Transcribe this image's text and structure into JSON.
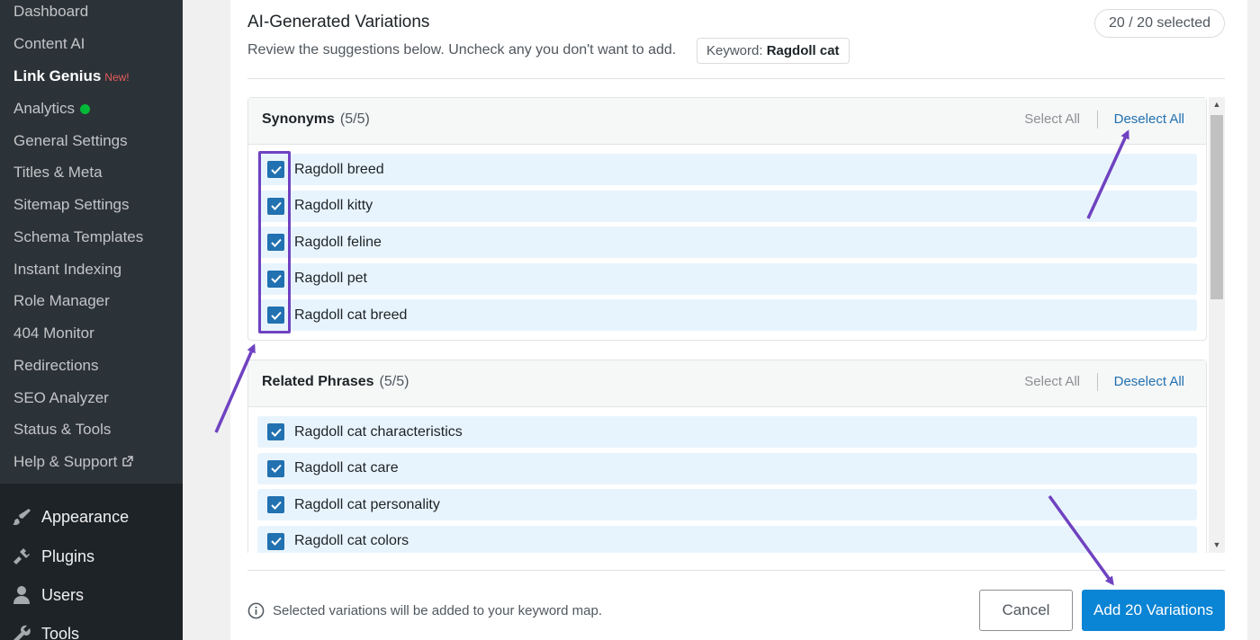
{
  "sidebar": {
    "sub_items": [
      {
        "label": "Dashboard"
      },
      {
        "label": "Content AI"
      },
      {
        "label": "Link Genius",
        "badge": "New!"
      },
      {
        "label": "Analytics",
        "status": "green-dot"
      },
      {
        "label": "General Settings"
      },
      {
        "label": "Titles & Meta"
      },
      {
        "label": "Sitemap Settings"
      },
      {
        "label": "Schema Templates"
      },
      {
        "label": "Instant Indexing"
      },
      {
        "label": "Role Manager"
      },
      {
        "label": "404 Monitor"
      },
      {
        "label": "Redirections"
      },
      {
        "label": "SEO Analyzer"
      },
      {
        "label": "Status & Tools"
      },
      {
        "label": "Help & Support",
        "icon": "external-link-icon"
      }
    ],
    "main_items": [
      {
        "label": "Appearance",
        "icon": "paintbrush-icon"
      },
      {
        "label": "Plugins",
        "icon": "plug-icon"
      },
      {
        "label": "Users",
        "icon": "user-icon"
      },
      {
        "label": "Tools",
        "icon": "wrench-icon"
      }
    ]
  },
  "modal": {
    "title": "AI-Generated Variations",
    "subtitle": "Review the suggestions below. Uncheck any you don't want to add.",
    "keyword_label": "Keyword:",
    "keyword_value": "Ragdoll cat",
    "selected_status": "20 / 20 selected",
    "sections": [
      {
        "title": "Synonyms",
        "count": "(5/5)",
        "select_all": "Select All",
        "deselect_all": "Deselect All",
        "items": [
          "Ragdoll breed",
          "Ragdoll kitty",
          "Ragdoll feline",
          "Ragdoll pet",
          "Ragdoll cat breed"
        ]
      },
      {
        "title": "Related Phrases",
        "count": "(5/5)",
        "select_all": "Select All",
        "deselect_all": "Deselect All",
        "items": [
          "Ragdoll cat characteristics",
          "Ragdoll cat care",
          "Ragdoll cat personality",
          "Ragdoll cat colors"
        ]
      }
    ],
    "footer_note": "Selected variations will be added to your keyword map.",
    "cancel_label": "Cancel",
    "add_label": "Add 20 Variations"
  },
  "colors": {
    "accent": "#2271b1",
    "primary_button": "#0a84d4",
    "annotation": "#6f42c1",
    "item_background": "#e8f4fd"
  }
}
